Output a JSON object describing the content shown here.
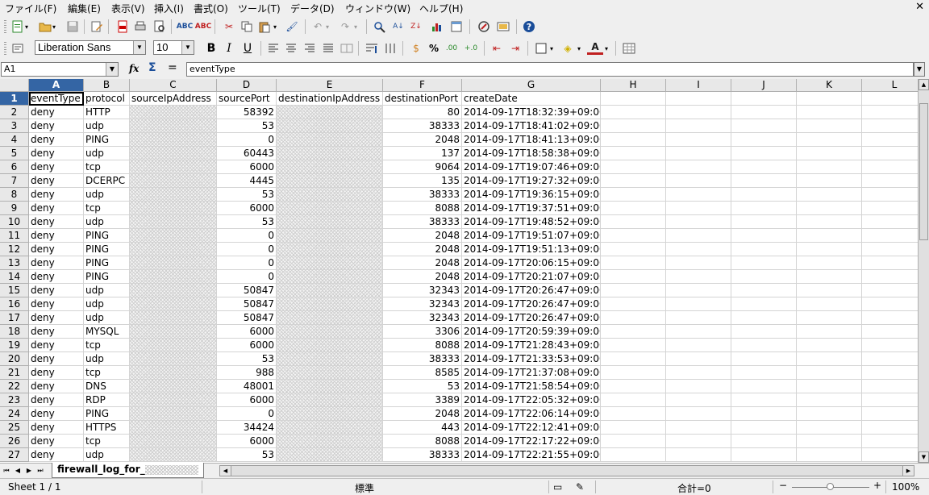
{
  "menu": [
    "ファイル(F)",
    "編集(E)",
    "表示(V)",
    "挿入(I)",
    "書式(O)",
    "ツール(T)",
    "データ(D)",
    "ウィンドウ(W)",
    "ヘルプ(H)"
  ],
  "font": {
    "name": "Liberation Sans",
    "size": "10"
  },
  "formula": {
    "cell_ref": "A1",
    "content": "eventType",
    "fx": "fx",
    "sum": "Σ",
    "equals": "="
  },
  "columns": [
    "A",
    "B",
    "C",
    "D",
    "E",
    "F",
    "G",
    "H",
    "I",
    "J",
    "K",
    "L"
  ],
  "header_row": [
    "eventType",
    "protocol",
    "sourceIpAddress",
    "sourcePort",
    "destinationIpAddress",
    "destinationPort",
    "createDate"
  ],
  "rows": [
    [
      "deny",
      "HTTP",
      "58392",
      "80",
      "2014-09-17T18:32:39+09:00"
    ],
    [
      "deny",
      "udp",
      "53",
      "38333",
      "2014-09-17T18:41:02+09:00"
    ],
    [
      "deny",
      "PING",
      "0",
      "2048",
      "2014-09-17T18:41:13+09:00"
    ],
    [
      "deny",
      "udp",
      "60443",
      "137",
      "2014-09-17T18:58:38+09:00"
    ],
    [
      "deny",
      "tcp",
      "6000",
      "9064",
      "2014-09-17T19:07:46+09:00"
    ],
    [
      "deny",
      "DCERPC",
      "4445",
      "135",
      "2014-09-17T19:27:32+09:00"
    ],
    [
      "deny",
      "udp",
      "53",
      "38333",
      "2014-09-17T19:36:15+09:00"
    ],
    [
      "deny",
      "tcp",
      "6000",
      "8088",
      "2014-09-17T19:37:51+09:00"
    ],
    [
      "deny",
      "udp",
      "53",
      "38333",
      "2014-09-17T19:48:52+09:00"
    ],
    [
      "deny",
      "PING",
      "0",
      "2048",
      "2014-09-17T19:51:07+09:00"
    ],
    [
      "deny",
      "PING",
      "0",
      "2048",
      "2014-09-17T19:51:13+09:00"
    ],
    [
      "deny",
      "PING",
      "0",
      "2048",
      "2014-09-17T20:06:15+09:00"
    ],
    [
      "deny",
      "PING",
      "0",
      "2048",
      "2014-09-17T20:21:07+09:00"
    ],
    [
      "deny",
      "udp",
      "50847",
      "32343",
      "2014-09-17T20:26:47+09:00"
    ],
    [
      "deny",
      "udp",
      "50847",
      "32343",
      "2014-09-17T20:26:47+09:00"
    ],
    [
      "deny",
      "udp",
      "50847",
      "32343",
      "2014-09-17T20:26:47+09:00"
    ],
    [
      "deny",
      "MYSQL",
      "6000",
      "3306",
      "2014-09-17T20:59:39+09:00"
    ],
    [
      "deny",
      "tcp",
      "6000",
      "8088",
      "2014-09-17T21:28:43+09:00"
    ],
    [
      "deny",
      "udp",
      "53",
      "38333",
      "2014-09-17T21:33:53+09:00"
    ],
    [
      "deny",
      "tcp",
      "988",
      "8585",
      "2014-09-17T21:37:08+09:00"
    ],
    [
      "deny",
      "DNS",
      "48001",
      "53",
      "2014-09-17T21:58:54+09:00"
    ],
    [
      "deny",
      "RDP",
      "6000",
      "3389",
      "2014-09-17T22:05:32+09:00"
    ],
    [
      "deny",
      "PING",
      "0",
      "2048",
      "2014-09-17T22:06:14+09:00"
    ],
    [
      "deny",
      "HTTPS",
      "34424",
      "443",
      "2014-09-17T22:12:41+09:00"
    ],
    [
      "deny",
      "tcp",
      "6000",
      "8088",
      "2014-09-17T22:17:22+09:00"
    ],
    [
      "deny",
      "udp",
      "53",
      "38333",
      "2014-09-17T22:21:55+09:00"
    ]
  ],
  "sheet_tab": "firewall_log_for_",
  "status": {
    "sheet": "Sheet 1 / 1",
    "style": "標準",
    "sum": "合計=0",
    "zoom": "100%"
  },
  "colors": {
    "selection": "#3465a4",
    "redaction": "#d0d0d0"
  }
}
